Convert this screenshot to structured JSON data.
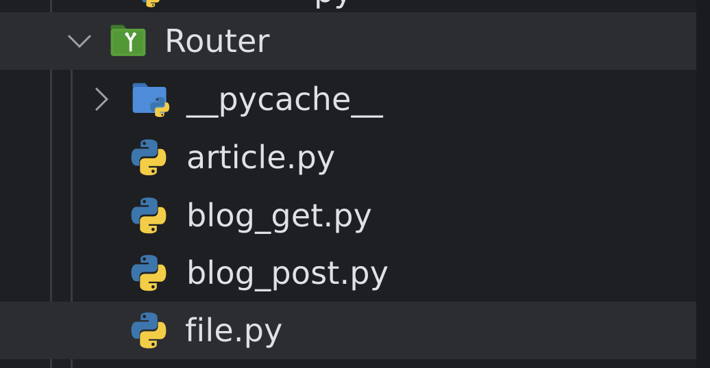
{
  "project_tree": {
    "previous_item_partial": {
      "text": "py"
    },
    "folder": {
      "name": "Router",
      "expanded": true
    },
    "children": [
      {
        "name": "__pycache__",
        "type": "folder",
        "collapsed": true
      },
      {
        "name": "article.py",
        "type": "python-file"
      },
      {
        "name": "blog_get.py",
        "type": "python-file"
      },
      {
        "name": "blog_post.py",
        "type": "python-file"
      },
      {
        "name": "file.py",
        "type": "python-file"
      }
    ]
  },
  "colors": {
    "background": "#1e1f22",
    "row_highlight": "#2b2d30",
    "text": "#dfe1e5",
    "python_blue": "#3d76ad",
    "python_yellow": "#f3cd47",
    "folder_blue": "#4f8cd9",
    "router_green": "#5aa03c"
  },
  "icons": {
    "router_folder": "package-folder-icon",
    "pycache_folder": "python-folder-icon",
    "python_file": "python-icon"
  }
}
